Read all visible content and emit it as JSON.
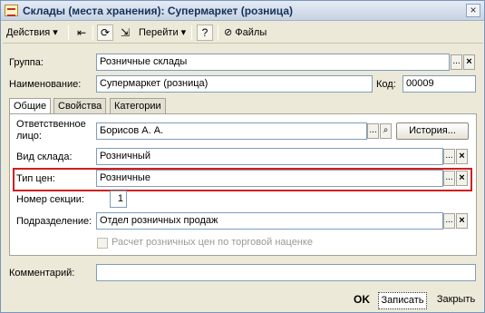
{
  "window": {
    "title": "Склады (места хранения): Супермаркет (розница)",
    "close_glyph": "×"
  },
  "toolbar": {
    "actions_label": "Действия",
    "goto_label": "Перейти",
    "help_glyph": "?",
    "files_label": "Файлы",
    "dropdown_glyph": "▾",
    "back_glyph": "⇤",
    "refresh_glyph": "⟳",
    "jump_glyph": "⇲",
    "clip_glyph": "⊘"
  },
  "form": {
    "group_label": "Группа:",
    "group_value": "Розничные склады",
    "name_label": "Наименование:",
    "name_value": "Супермаркет (розница)",
    "code_label": "Код:",
    "code_value": "00009",
    "comment_label": "Комментарий:",
    "comment_value": ""
  },
  "tabs": [
    {
      "label": "Общие",
      "active": true
    },
    {
      "label": "Свойства",
      "active": false
    },
    {
      "label": "Категории",
      "active": false
    }
  ],
  "general_tab": {
    "responsible_label_line1": "Ответственное",
    "responsible_label_line2": "лицо:",
    "responsible_value": "Борисов А. А.",
    "history_button": "История...",
    "warehouse_type_label": "Вид склада:",
    "warehouse_type_value": "Розничный",
    "price_type_label": "Тип цен:",
    "price_type_value": "Розничные",
    "section_number_label": "Номер секции:",
    "section_number_value": "1",
    "department_label": "Подразделение:",
    "department_value": "Отдел розничных продаж",
    "retail_markup_checkbox_label": "Расчет розничных цен по торговой наценке",
    "retail_markup_checked": false
  },
  "buttons": {
    "select_glyph": "...",
    "clear_glyph": "×",
    "search_glyph": "⌕"
  },
  "footer": {
    "ok_label": "OK",
    "save_label": "Записать",
    "close_label": "Закрыть"
  },
  "colors": {
    "highlight_frame": "#d01f1f",
    "field_border": "#7f9db9",
    "window_bg": "#ece9d8"
  }
}
